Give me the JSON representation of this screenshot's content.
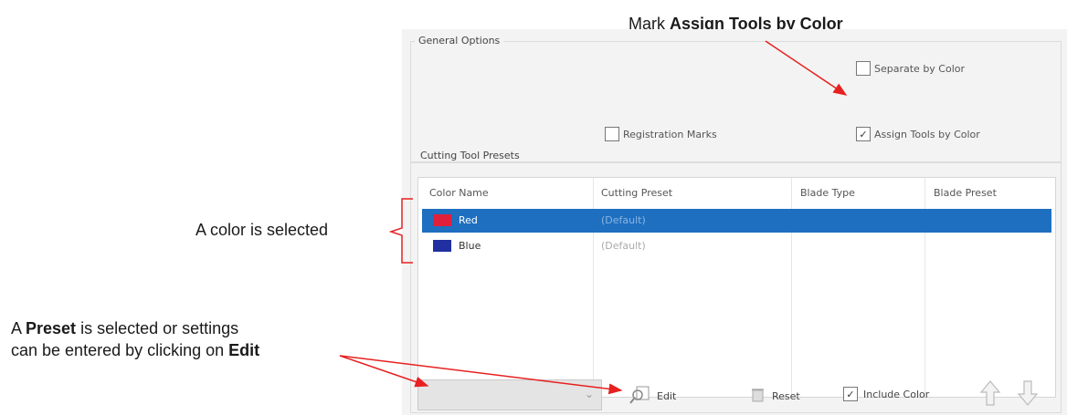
{
  "annotations": {
    "top_prefix": "Mark ",
    "top_bold": "Assign Tools by Color",
    "left_color": "A color is selected",
    "preset_line1_a": "A ",
    "preset_line1_bold": "Preset",
    "preset_line1_b": " is selected or settings",
    "preset_line2_a": "can be entered by clicking on ",
    "preset_line2_bold": "Edit"
  },
  "general_options": {
    "title": "General Options",
    "separate_by_color": {
      "label": "Separate by Color",
      "checked": false
    },
    "registration_marks": {
      "label": "Registration Marks",
      "checked": false
    },
    "assign_tools_by_color": {
      "label": "Assign Tools by Color",
      "checked": true
    }
  },
  "presets": {
    "title": "Cutting Tool Presets",
    "columns": [
      "Color Name",
      "Cutting Preset",
      "Blade Type",
      "Blade Preset"
    ],
    "rows": [
      {
        "swatch": "#e0203a",
        "name": "Red",
        "preset": "(Default)",
        "selected": true
      },
      {
        "swatch": "#2030a0",
        "name": "Blue",
        "preset": "(Default)",
        "selected": false
      }
    ]
  },
  "toolbar": {
    "dropdown_value": "",
    "edit_label": "Edit",
    "reset_label": "Reset",
    "include_color_label": "Include Color",
    "include_color_checked": true
  }
}
